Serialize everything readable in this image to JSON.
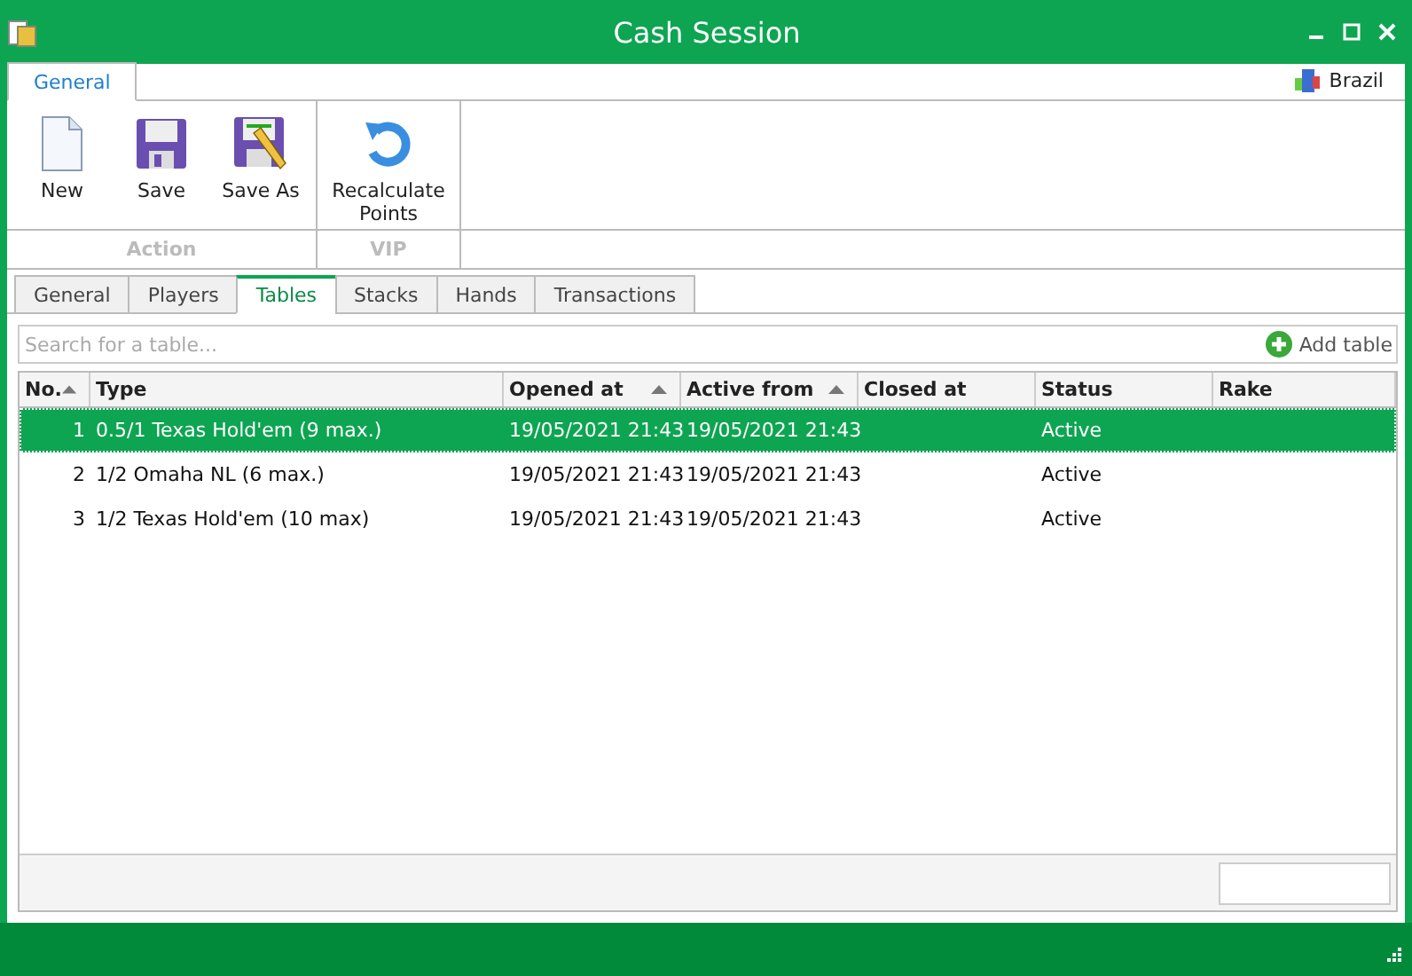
{
  "window": {
    "title": "Cash Session"
  },
  "ribbon": {
    "tabs": [
      {
        "label": "General",
        "selected": true
      }
    ],
    "region": "Brazil",
    "groups": [
      {
        "label": "Action",
        "buttons": [
          {
            "label": "New"
          },
          {
            "label": "Save"
          },
          {
            "label": "Save As"
          }
        ]
      },
      {
        "label": "VIP",
        "buttons": [
          {
            "label": "Recalculate Points"
          }
        ]
      }
    ]
  },
  "tabs": [
    {
      "label": "General",
      "selected": false
    },
    {
      "label": "Players",
      "selected": false
    },
    {
      "label": "Tables",
      "selected": true
    },
    {
      "label": "Stacks",
      "selected": false
    },
    {
      "label": "Hands",
      "selected": false
    },
    {
      "label": "Transactions",
      "selected": false
    }
  ],
  "search": {
    "placeholder": "Search for a table..."
  },
  "add_button": "Add table",
  "table": {
    "columns": [
      {
        "label": "No.",
        "sorted": true
      },
      {
        "label": "Type",
        "sorted": false
      },
      {
        "label": "Opened at",
        "sorted": true
      },
      {
        "label": "Active from",
        "sorted": true
      },
      {
        "label": "Closed at",
        "sorted": false
      },
      {
        "label": "Status",
        "sorted": false
      },
      {
        "label": "Rake",
        "sorted": false
      }
    ],
    "rows": [
      {
        "selected": true,
        "cells": [
          "1",
          "0.5/1 Texas Hold'em (9 max.)",
          "19/05/2021 21:43",
          "19/05/2021 21:43",
          "",
          "Active",
          ""
        ]
      },
      {
        "selected": false,
        "cells": [
          "2",
          "1/2 Omaha NL (6 max.)",
          "19/05/2021 21:43",
          "19/05/2021 21:43",
          "",
          "Active",
          ""
        ]
      },
      {
        "selected": false,
        "cells": [
          "3",
          "1/2 Texas Hold'em (10 max)",
          "19/05/2021 21:43",
          "19/05/2021 21:43",
          "",
          "Active",
          ""
        ]
      }
    ]
  }
}
